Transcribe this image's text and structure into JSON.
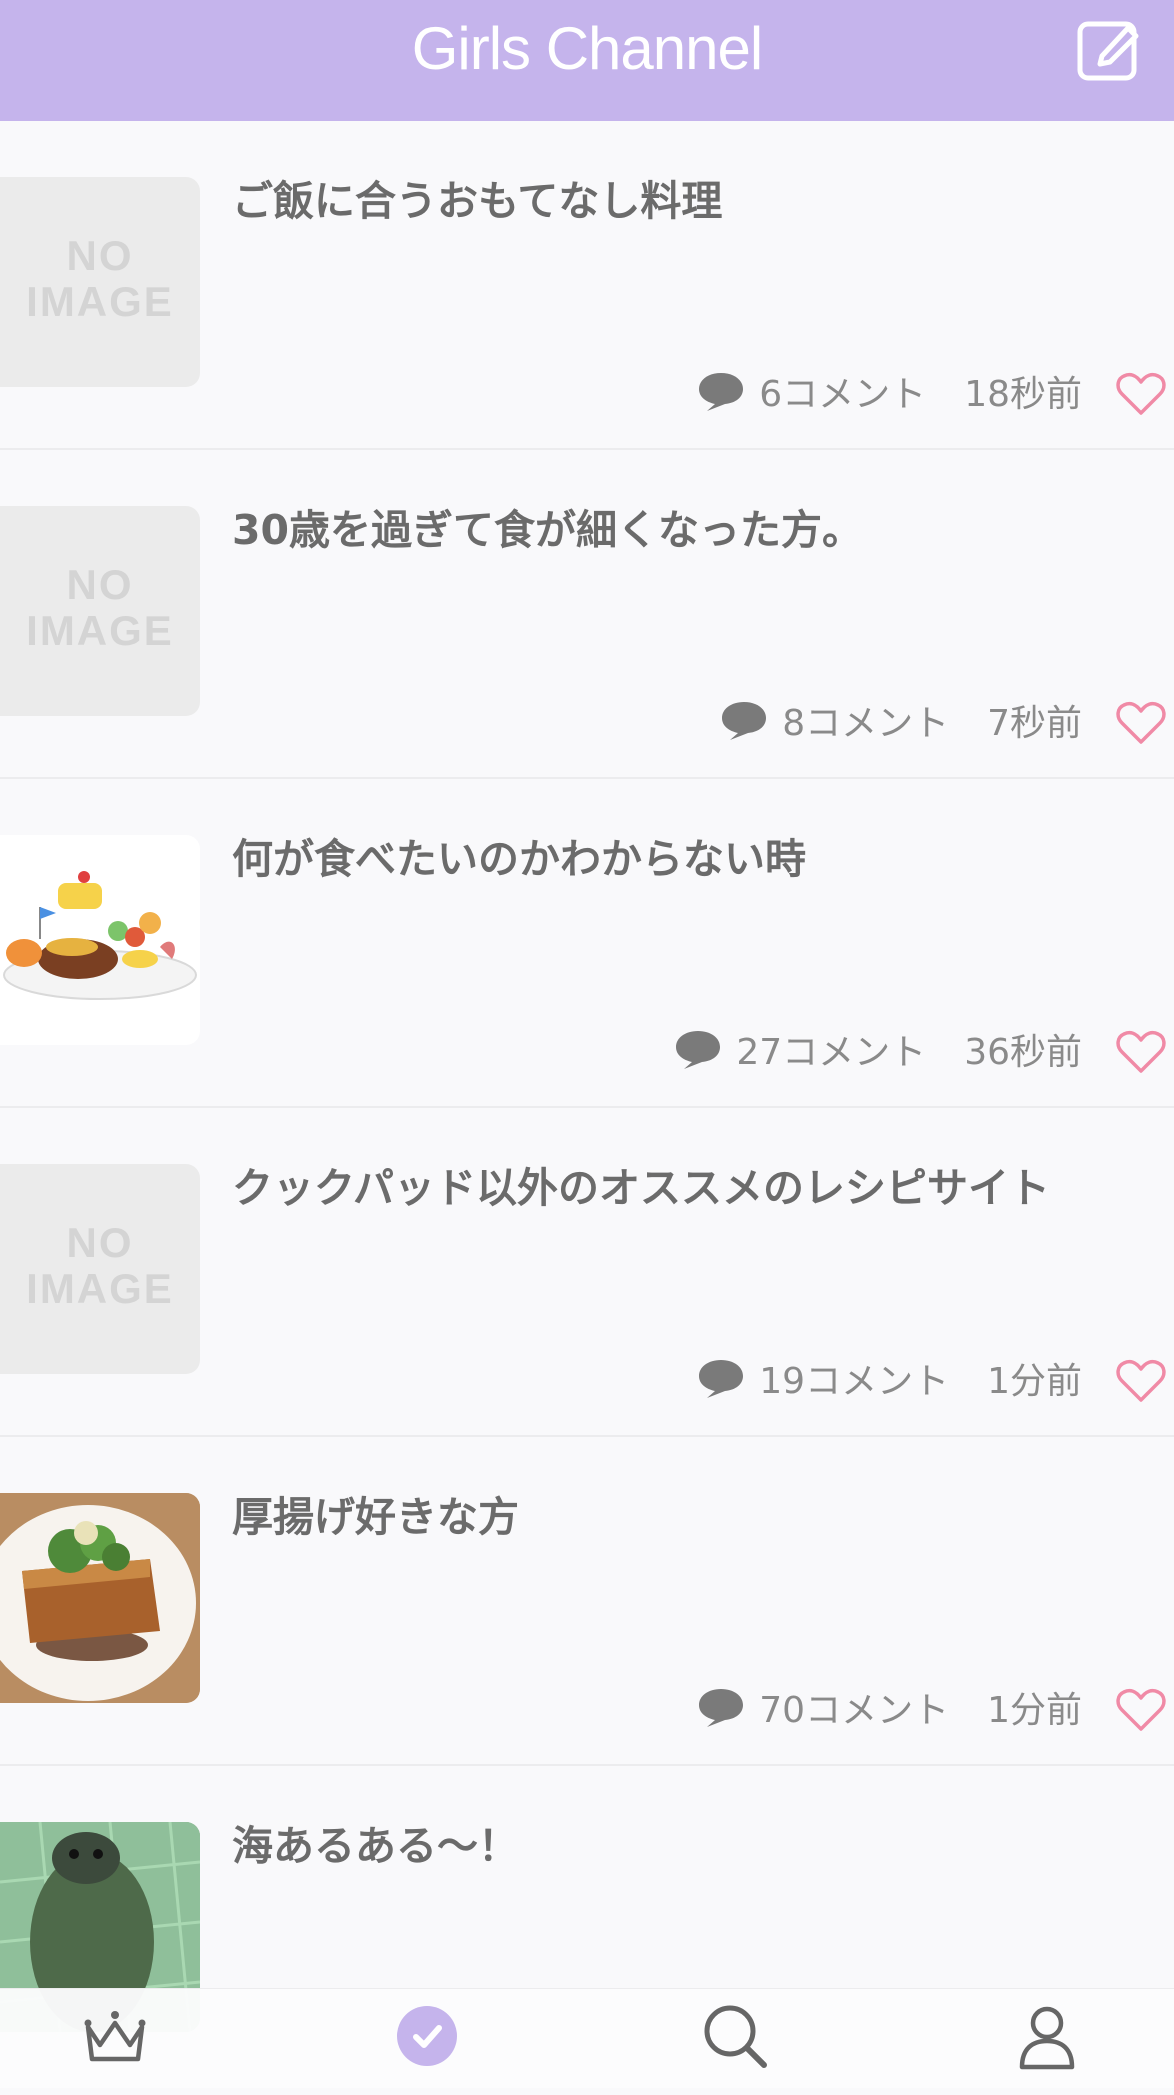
{
  "header": {
    "title": "Girls Channel"
  },
  "icons": {
    "compose": "compose-icon",
    "comment": "speech-bubble-icon",
    "favorite": "heart-outline-icon",
    "ranking": "crown-icon",
    "checked": "check-circle-icon",
    "search": "search-icon",
    "profile": "person-icon"
  },
  "colors": {
    "header_bg": "#c5b4ec",
    "accent": "#c5b4ec",
    "heart": "#f08aa6",
    "text": "#6b6b6b"
  },
  "items": [
    {
      "title": "ご飯に合うおもてなし料理",
      "comments": "6コメント",
      "time": "18秒前",
      "thumb_text": "NO IMAGE"
    },
    {
      "title": "30歳を過ぎて食が細くなった方。",
      "comments": "8コメント",
      "time": "7秒前",
      "thumb_text": "NO IMAGE"
    },
    {
      "title": "何が食べたいのかわからない時",
      "comments": "27コメント",
      "time": "36秒前"
    },
    {
      "title": "クックパッド以外のオススメのレシピサイト",
      "comments": "19コメント",
      "time": "1分前",
      "thumb_text": "NO IMAGE"
    },
    {
      "title": "厚揚げ好きな方",
      "comments": "70コメント",
      "time": "1分前"
    },
    {
      "title": "海あるある〜！"
    }
  ]
}
